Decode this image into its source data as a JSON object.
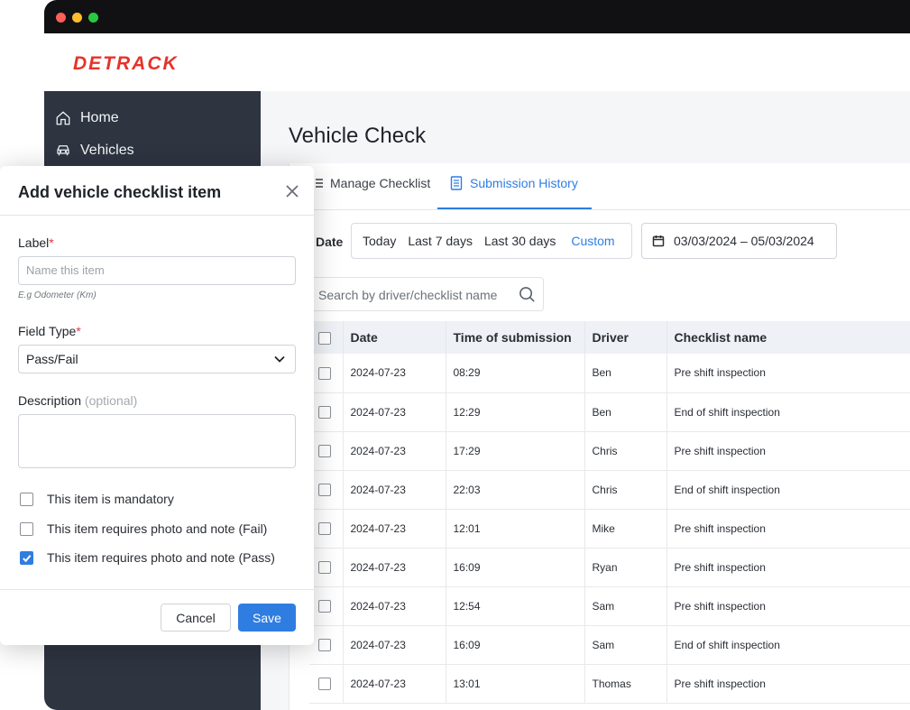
{
  "brand": {
    "logo": "DETRACK",
    "accent": "#e63329",
    "primary": "#2f7de1"
  },
  "sidebar": {
    "items": [
      {
        "label": "Home",
        "icon": "home-icon"
      },
      {
        "label": "Vehicles",
        "icon": "car-icon"
      }
    ]
  },
  "page": {
    "title": "Vehicle Check"
  },
  "tabs": [
    {
      "label": "Manage Checklist",
      "icon": "list-icon",
      "active": false
    },
    {
      "label": "Submission History",
      "icon": "document-icon",
      "active": true
    }
  ],
  "filters": {
    "date_label": "Date",
    "ranges": [
      "Today",
      "Last 7 days",
      "Last 30 days",
      "Custom"
    ],
    "selected_range": "Custom",
    "date_range": "03/03/2024 – 05/03/2024",
    "search_placeholder": "Search by driver/checklist name"
  },
  "table": {
    "headers": [
      "Date",
      "Time of submission",
      "Driver",
      "Checklist name"
    ],
    "rows": [
      {
        "date": "2024-07-23",
        "time": "08:29",
        "driver": "Ben",
        "checklist": "Pre shift inspection"
      },
      {
        "date": "2024-07-23",
        "time": "12:29",
        "driver": "Ben",
        "checklist": "End of shift inspection"
      },
      {
        "date": "2024-07-23",
        "time": "17:29",
        "driver": "Chris",
        "checklist": "Pre shift inspection"
      },
      {
        "date": "2024-07-23",
        "time": "22:03",
        "driver": "Chris",
        "checklist": "End of shift inspection"
      },
      {
        "date": "2024-07-23",
        "time": "12:01",
        "driver": "Mike",
        "checklist": "Pre shift inspection"
      },
      {
        "date": "2024-07-23",
        "time": "16:09",
        "driver": "Ryan",
        "checklist": "Pre shift inspection"
      },
      {
        "date": "2024-07-23",
        "time": "12:54",
        "driver": "Sam",
        "checklist": "Pre shift inspection"
      },
      {
        "date": "2024-07-23",
        "time": "16:09",
        "driver": "Sam",
        "checklist": "End of shift inspection"
      },
      {
        "date": "2024-07-23",
        "time": "13:01",
        "driver": "Thomas",
        "checklist": "Pre shift inspection"
      }
    ]
  },
  "modal": {
    "title": "Add vehicle checklist item",
    "label_field": {
      "label": "Label",
      "required_mark": "*",
      "placeholder": "Name this item",
      "hint": "E.g Odometer (Km)"
    },
    "field_type": {
      "label": "Field Type",
      "required_mark": "*",
      "value": "Pass/Fail"
    },
    "description": {
      "label": "Description",
      "optional": "(optional)"
    },
    "checkboxes": [
      {
        "label": "This item is mandatory",
        "checked": false
      },
      {
        "label": "This item requires photo and note (Fail)",
        "checked": false
      },
      {
        "label": "This item requires photo and note (Pass)",
        "checked": true
      }
    ],
    "cancel_label": "Cancel",
    "save_label": "Save"
  }
}
